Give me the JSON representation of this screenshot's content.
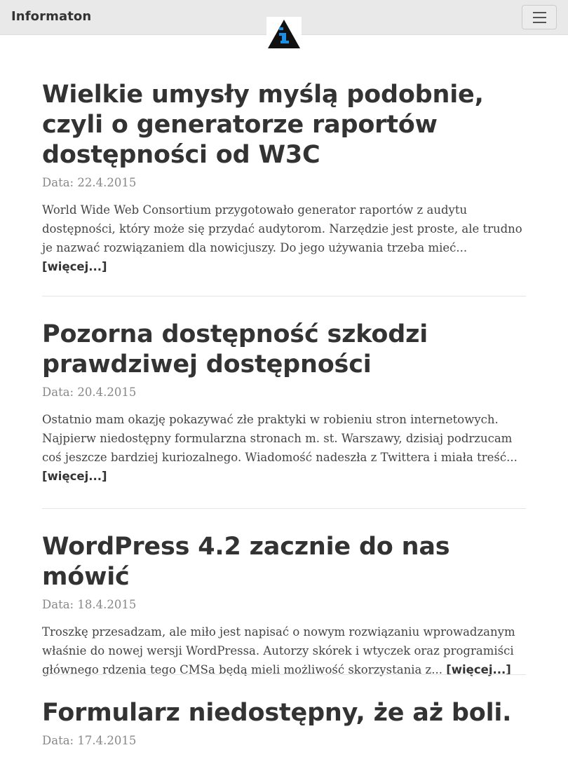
{
  "navbar": {
    "brand": "Informaton",
    "logo_icon": "info-triangle-icon",
    "menu_icon": "hamburger-icon"
  },
  "posts": [
    {
      "title": "Wielkie umysły myślą podobnie, czyli o generatorze raportów dostępności od W3C",
      "date": "Data: 22.4.2015",
      "excerpt": "World Wide Web Consortium przygotowało generator raportów z audytu dostępności, który może się przydać audytorom. Narzędzie jest proste, ale trudno je nazwać rozwiązaniem dla nowicjuszy. Do jego używania trzeba mieć...",
      "more": "[więcej...]"
    },
    {
      "title": "Pozorna dostępność szkodzi prawdziwej dostępności",
      "date": "Data: 20.4.2015",
      "excerpt": "Ostatnio mam okazję pokazywać złe praktyki w robieniu stron internetowych. Najpierw niedostępny formularzna stronach m. st. Warszawy, dzisiaj podrzucam coś jeszcze bardziej kuriozalnego. Wiadomość nadeszła z Twittera i miała treść...",
      "more": "[więcej...]"
    },
    {
      "title": "WordPress 4.2 zacznie do nas mówić",
      "date": "Data: 18.4.2015",
      "excerpt": "Troszkę przesadzam, ale miło jest napisać o nowym rozwiązaniu wprowadzanym właśnie do nowej wersji WordPressa. Autorzy skórek i wtyczek oraz programiści głównego rdzenia tego CMSa będą mieli możliwość skorzystania z...",
      "more": "[więcej...]"
    },
    {
      "title": "Formularz niedostępny, że aż boli.",
      "date": "Data: 17.4.2015"
    }
  ],
  "colors": {
    "navbar_bg": "#e9e9e9",
    "title": "#333333",
    "date": "#888888",
    "body_text": "#444444",
    "logo_blue": "#1a8fe3"
  }
}
